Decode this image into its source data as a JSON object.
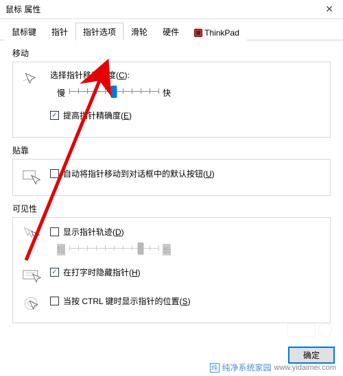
{
  "window": {
    "title": "鼠标 属性"
  },
  "tabs": [
    "鼠标键",
    "指针",
    "指针选项",
    "滑轮",
    "硬件",
    "ThinkPad"
  ],
  "active_tab_index": 2,
  "groups": {
    "motion": {
      "title": "移动",
      "speed_label": "选择指针移动速度(C):",
      "slow": "慢",
      "fast": "快",
      "slider_value": 6,
      "slider_max": 11,
      "enhance_precision": {
        "checked": true,
        "label": "提高指针精确度(E)"
      }
    },
    "snap": {
      "title": "贴靠",
      "auto_snap": {
        "checked": false,
        "label": "自动将指针移动到对话框中的默认按钮(U)"
      }
    },
    "visibility": {
      "title": "可见性",
      "trails": {
        "checked": false,
        "label": "显示指针轨迹(D)"
      },
      "short": "短",
      "long": "长",
      "trail_value": 9,
      "trail_max": 11,
      "hide_typing": {
        "checked": true,
        "label": "在打字时隐藏指针(H)"
      },
      "ctrl_locate": {
        "checked": false,
        "label": "当按 CTRL 键时显示指针的位置(S)"
      }
    }
  },
  "buttons": {
    "ok": "确定"
  },
  "watermark": {
    "brand": "纯净系统家园",
    "url": "www.yidaimei.com"
  }
}
